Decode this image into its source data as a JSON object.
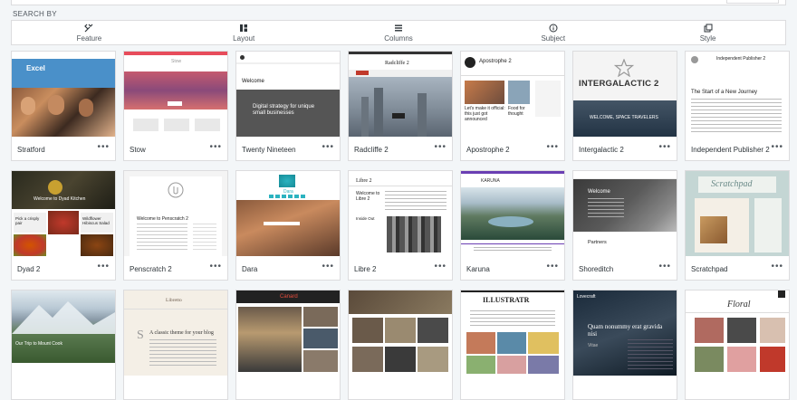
{
  "search": {
    "label": "SEARCH BY",
    "filters": [
      {
        "label": "Feature",
        "icon": "tools-icon"
      },
      {
        "label": "Layout",
        "icon": "layout-icon"
      },
      {
        "label": "Columns",
        "icon": "columns-icon"
      },
      {
        "label": "Subject",
        "icon": "info-icon"
      },
      {
        "label": "Style",
        "icon": "style-icon"
      }
    ]
  },
  "themes": [
    {
      "name": "Stratford",
      "more": "•••",
      "thumb": {
        "heading": "Excel"
      }
    },
    {
      "name": "Stow",
      "more": "•••",
      "thumb": {
        "heading": "Stow"
      }
    },
    {
      "name": "Twenty Nineteen",
      "more": "•••",
      "thumb": {
        "heading": "Welcome",
        "text": "Digital strategy for unique small businesses"
      }
    },
    {
      "name": "Radcliffe 2",
      "more": "•••",
      "thumb": {
        "heading": "Radcliffe 2"
      }
    },
    {
      "name": "Apostrophe 2",
      "more": "•••",
      "thumb": {
        "heading": "Apostrophe 2",
        "caption1": "Let's make it official: this just got announced",
        "caption2": "Food for thought"
      }
    },
    {
      "name": "Intergalactic 2",
      "more": "•••",
      "thumb": {
        "heading": "INTERGALACTIC 2",
        "sub": "WELCOME, SPACE TRAVELERS"
      }
    },
    {
      "name": "Independent Publisher 2",
      "more": "•••",
      "thumb": {
        "heading": "Independent Publisher 2",
        "title": "The Start of a New Journey"
      }
    },
    {
      "name": "Dyad 2",
      "more": "•••",
      "thumb": {
        "heading": "Welcome to Dyad Kitchen",
        "caption1": "Pick a crisply pair",
        "caption2": "Wildflower Hibiscus Salad"
      }
    },
    {
      "name": "Penscratch 2",
      "more": "•••",
      "thumb": {
        "heading": "Welcome to Penscratch 2"
      }
    },
    {
      "name": "Dara",
      "more": "•••",
      "thumb": {
        "heading": "Dara"
      }
    },
    {
      "name": "Libre 2",
      "more": "•••",
      "thumb": {
        "heading": "Libre 2",
        "title": "Welcome to Libre 2",
        "sub": "Inside Out"
      }
    },
    {
      "name": "Karuna",
      "more": "•••",
      "thumb": {
        "heading": "KARUNA"
      }
    },
    {
      "name": "Shoreditch",
      "more": "•••",
      "thumb": {
        "heading": "Welcome",
        "sub": "Partners"
      }
    },
    {
      "name": "Scratchpad",
      "more": "•••",
      "thumb": {
        "heading": "Scratchpad"
      }
    },
    {
      "name": "",
      "more": "",
      "thumb": {
        "heading": "Our Trip to Mount Cook"
      }
    },
    {
      "name": "",
      "more": "",
      "thumb": {
        "heading": "Libretto",
        "title": "A classic theme for your blog"
      }
    },
    {
      "name": "",
      "more": "",
      "thumb": {
        "heading": "Canard"
      }
    },
    {
      "name": "",
      "more": "",
      "thumb": {
        "heading": ""
      }
    },
    {
      "name": "",
      "more": "",
      "thumb": {
        "heading": "ILLUSTRATR"
      }
    },
    {
      "name": "",
      "more": "",
      "thumb": {
        "heading": "Lovecraft",
        "title": "Quam nonummy erat gravida nisi",
        "sub": "Vitae"
      }
    },
    {
      "name": "",
      "more": "",
      "thumb": {
        "heading": "Floral"
      }
    }
  ]
}
